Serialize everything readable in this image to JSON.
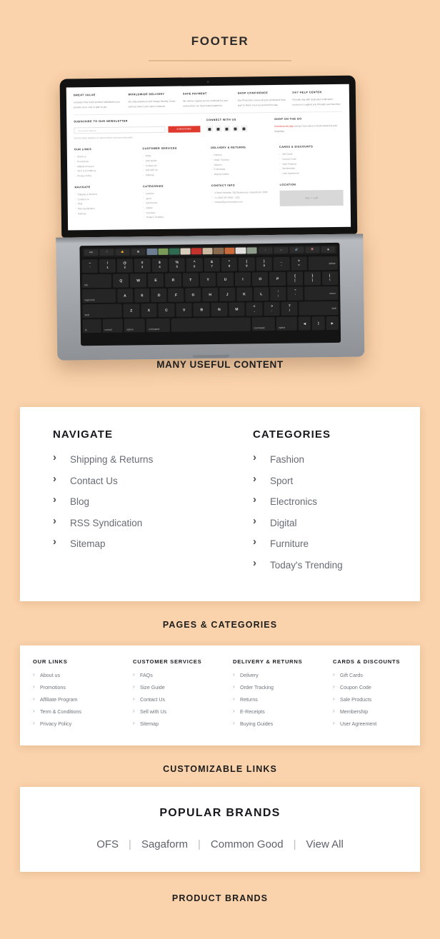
{
  "page": {
    "title": "FOOTER",
    "background_color": "#fad2ab",
    "accent_color": "#e03a2f"
  },
  "captions": {
    "laptop": "MANY USEFUL CONTENT",
    "navigate": "PAGES & CATEGORIES",
    "links": "CUSTOMIZABLE LINKS",
    "brands": "PRODUCT BRANDS"
  },
  "laptop_preview": {
    "features": [
      {
        "title": "GREAT VALUE",
        "text": "Consider how much product satisfaction you provide at no cost or pain to get."
      },
      {
        "title": "WORLDWIDE DELIVERY",
        "text": "We ship anywhere and charge literally. Come with our lower-cost courier network."
      },
      {
        "title": "SAFE PAYMENT",
        "text": "We deliver regular secure methods for your orders from our most trusted partners."
      },
      {
        "title": "SHOP CONFIDENCE",
        "text": "Our Protection covers all your purchases from start to finish. Feel secured before pay."
      },
      {
        "title": "24/7 HELP CENTER",
        "text": "Friendly day with dedicated notification services to support you through your favorites."
      }
    ],
    "newsletter": {
      "heading": "SUBSCRIBE TO OUR NEWSLETTER",
      "placeholder": "Your email address",
      "button": "SUBSCRIBE",
      "note": "Get the latest updates on new products and upcoming sales"
    },
    "connect": {
      "heading": "CONNECT WITH US",
      "icons": [
        "twitter-icon",
        "facebook-icon",
        "pinterest-icon",
        "youtube-icon",
        "instagram-icon"
      ]
    },
    "shop_on_go": {
      "heading": "SHOP ON THE GO",
      "link": "Download the App",
      "text": "and get new sales or book started at your fingertips."
    },
    "columns": [
      {
        "title": "OUR LINKS",
        "items": [
          "About us",
          "Promotions",
          "Affiliate Program",
          "Term & Conditions",
          "Privacy Policy"
        ]
      },
      {
        "title": "CUSTOMER SERVICES",
        "items": [
          "FAQs",
          "Size Guide",
          "Contact Us",
          "Sell with Us",
          "Sitemap"
        ]
      },
      {
        "title": "DELIVERY & RETURNS",
        "items": [
          "Delivery",
          "Order Tracking",
          "Returns",
          "E-Receipts",
          "Buying Guides"
        ]
      },
      {
        "title": "CARDS & DISCOUNTS",
        "items": [
          "Gift Cards",
          "Coupon Code",
          "Sale Products",
          "Membership",
          "User Agreement"
        ]
      }
    ],
    "columns2": [
      {
        "title": "NAVIGATE",
        "items": [
          "Shipping & Returns",
          "Contact Us",
          "FAQ",
          "RSS Syndication",
          "Sitemap"
        ]
      },
      {
        "title": "CATEGORIES",
        "items": [
          "Fashion",
          "Sport",
          "Electronics",
          "Digital",
          "Furniture",
          "Today's Trending"
        ]
      },
      {
        "title": "CONTACT INFO",
        "items": [
          "4 Street Website, Old Warehouse, Australia AU 2000",
          "+1 (234) 567 8910 - 1911",
          "contact@yourcompany.com"
        ]
      },
      {
        "title": "LOCATION",
        "map_placeholder": "320 × 130"
      }
    ],
    "keyboard": {
      "touchbar_keys": [
        "esc",
        "heart-icon",
        "thumbsup-icon",
        "image-icon"
      ],
      "touchbar_right": [
        "chevron-left-icon",
        "brightness-icon",
        "volume-icon",
        "mute-icon",
        "siri-icon"
      ],
      "row_numbers": [
        {
          "top": "~",
          "bot": "`"
        },
        {
          "top": "!",
          "bot": "1"
        },
        {
          "top": "@",
          "bot": "2"
        },
        {
          "top": "#",
          "bot": "3"
        },
        {
          "top": "$",
          "bot": "4"
        },
        {
          "top": "%",
          "bot": "5"
        },
        {
          "top": "^",
          "bot": "6"
        },
        {
          "top": "&",
          "bot": "7"
        },
        {
          "top": "*",
          "bot": "8"
        },
        {
          "top": "(",
          "bot": "9"
        },
        {
          "top": ")",
          "bot": "0"
        },
        {
          "top": "_",
          "bot": "-"
        },
        {
          "top": "+",
          "bot": "="
        }
      ],
      "delete_label": "delete",
      "row_q": [
        "tab",
        "Q",
        "W",
        "E",
        "R",
        "T",
        "Y",
        "U",
        "I",
        "O",
        "P",
        "{",
        "}",
        "|"
      ],
      "row_a": [
        "caps lock",
        "A",
        "S",
        "D",
        "F",
        "G",
        "H",
        "J",
        "K",
        "L",
        ":",
        "\"",
        "return"
      ],
      "row_z": [
        "shift",
        "Z",
        "X",
        "C",
        "V",
        "B",
        "N",
        "M",
        "<",
        ">",
        "?",
        "shift"
      ],
      "row_bottom": [
        "fn",
        "control",
        "option",
        "command",
        "",
        "command",
        "option"
      ]
    }
  },
  "navigate_section": {
    "columns": [
      {
        "title": "NAVIGATE",
        "items": [
          "Shipping & Returns",
          "Contact Us",
          "Blog",
          "RSS Syndication",
          "Sitemap"
        ]
      },
      {
        "title": "CATEGORIES",
        "items": [
          "Fashion",
          "Sport",
          "Electronics",
          "Digital",
          "Furniture",
          "Today's Trending"
        ]
      }
    ]
  },
  "links_section": {
    "columns": [
      {
        "title": "OUR LINKS",
        "items": [
          "About us",
          "Promotions",
          "Affiliate Program",
          "Term & Conditions",
          "Privacy Policy"
        ]
      },
      {
        "title": "CUSTOMER SERVICES",
        "items": [
          "FAQs",
          "Size Guide",
          "Contact Us",
          "Sell with Us",
          "Sitemap"
        ]
      },
      {
        "title": "DELIVERY & RETURNS",
        "items": [
          "Delivery",
          "Order Tracking",
          "Returns",
          "E-Receipts",
          "Buying Guides"
        ]
      },
      {
        "title": "CARDS & DISCOUNTS",
        "items": [
          "Gift Cards",
          "Coupon Code",
          "Sale Products",
          "Membership",
          "User Agreement"
        ]
      }
    ]
  },
  "brands_section": {
    "title": "POPULAR BRANDS",
    "brands": [
      "OFS",
      "Sagaform",
      "Common Good",
      "View All"
    ],
    "divider": "|"
  }
}
